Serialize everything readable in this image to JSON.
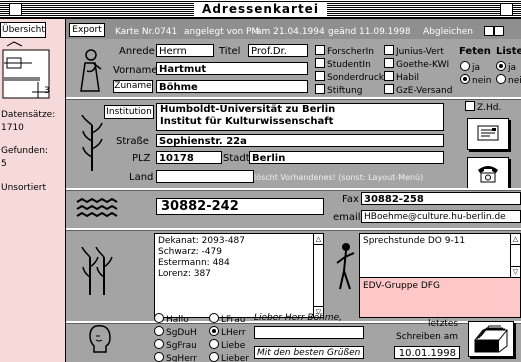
{
  "window": {
    "title": "Adressenkartei"
  },
  "sidebar": {
    "uebersicht": "Übersicht",
    "page_number": "3",
    "datensaetze_label": "Datensätze:",
    "datensaetze_value": "1710",
    "gefunden_label": "Gefunden:",
    "gefunden_value": "5",
    "sort": "Unsortiert"
  },
  "toolbar": {
    "export": "Export",
    "karte": "Karte Nr.0741",
    "angelegt": "angelegt von PM",
    "am": "am 21.04.1994",
    "geaendert": "geänd 11.09.1998",
    "abgleichen": "Abgleichen"
  },
  "person": {
    "anrede_label": "Anrede",
    "anrede": "Herrn",
    "titel_label": "Titel",
    "titel": "Prof.Dr.",
    "vorname_label": "Vorname",
    "vorname": "Hartmut",
    "zuname_label": "Zuname",
    "zuname": "Böhme"
  },
  "categories": [
    "ForscherIn",
    "StudentIn",
    "Sonderdruck",
    "Stiftung",
    "Junius-Vert",
    "Goethe-KWI",
    "Habil",
    "GzE-Versand"
  ],
  "feten": {
    "title": "Feten",
    "ja": "ja",
    "nein": "nein"
  },
  "liste": {
    "title": "Liste",
    "ja": "ja",
    "nein": "nein"
  },
  "address": {
    "institution_button": "Institution",
    "institution_line1": "Humboldt-Universität zu Berlin",
    "institution_line2": "Institut für Kulturwissenschaft",
    "zhd": "Z.Hd.",
    "strasse_label": "Straße",
    "strasse": "Sophienstr. 22a",
    "plz_label": "PLZ",
    "plz": "10178",
    "stadt_label": "Stadt",
    "stadt": "Berlin",
    "land_label": "Land",
    "hint": "löscht Vorhandenes! (sonst: Layout-Menü)"
  },
  "contact": {
    "phone": "30882-242",
    "fax_label": "Fax",
    "fax": "30882-258",
    "email_label": "email",
    "email": "HBoehme@culture.hu-berlin.de"
  },
  "notes": {
    "phones": [
      "Dekanat: 2093-487",
      "Schwarz: -479",
      "Estermann: 484",
      "Lorenz: 387"
    ],
    "memo": "Sprechstunde DO 9-11",
    "group": "EDV-Gruppe DFG"
  },
  "greeting": {
    "options_col1": [
      "Hallo",
      "SgDuH",
      "SgFrau",
      "SgHerr"
    ],
    "options_col2": [
      "LFrau",
      "LHerr",
      "Liebe",
      "Lieber"
    ],
    "selected": "LHerr",
    "salutation": "Lieber Herr Böhme,",
    "closing": "Mit den besten Grüßen",
    "letztes_label": "letztes",
    "schreiben_label": "Schreiben am",
    "date": "10.01.1998"
  },
  "colors": {
    "panel": "#a4a4a4",
    "sidebar": "#f6dada",
    "pink_field": "#ffc8c8"
  },
  "icons": [
    "close-box-icon",
    "zoom-box-icon",
    "hieroglyph-figure-icon",
    "reed-icon",
    "water-icon",
    "reed-pair-icon",
    "scribe-icon",
    "head-icon",
    "letter-icon",
    "telephone-icon",
    "file-tray-icon"
  ]
}
